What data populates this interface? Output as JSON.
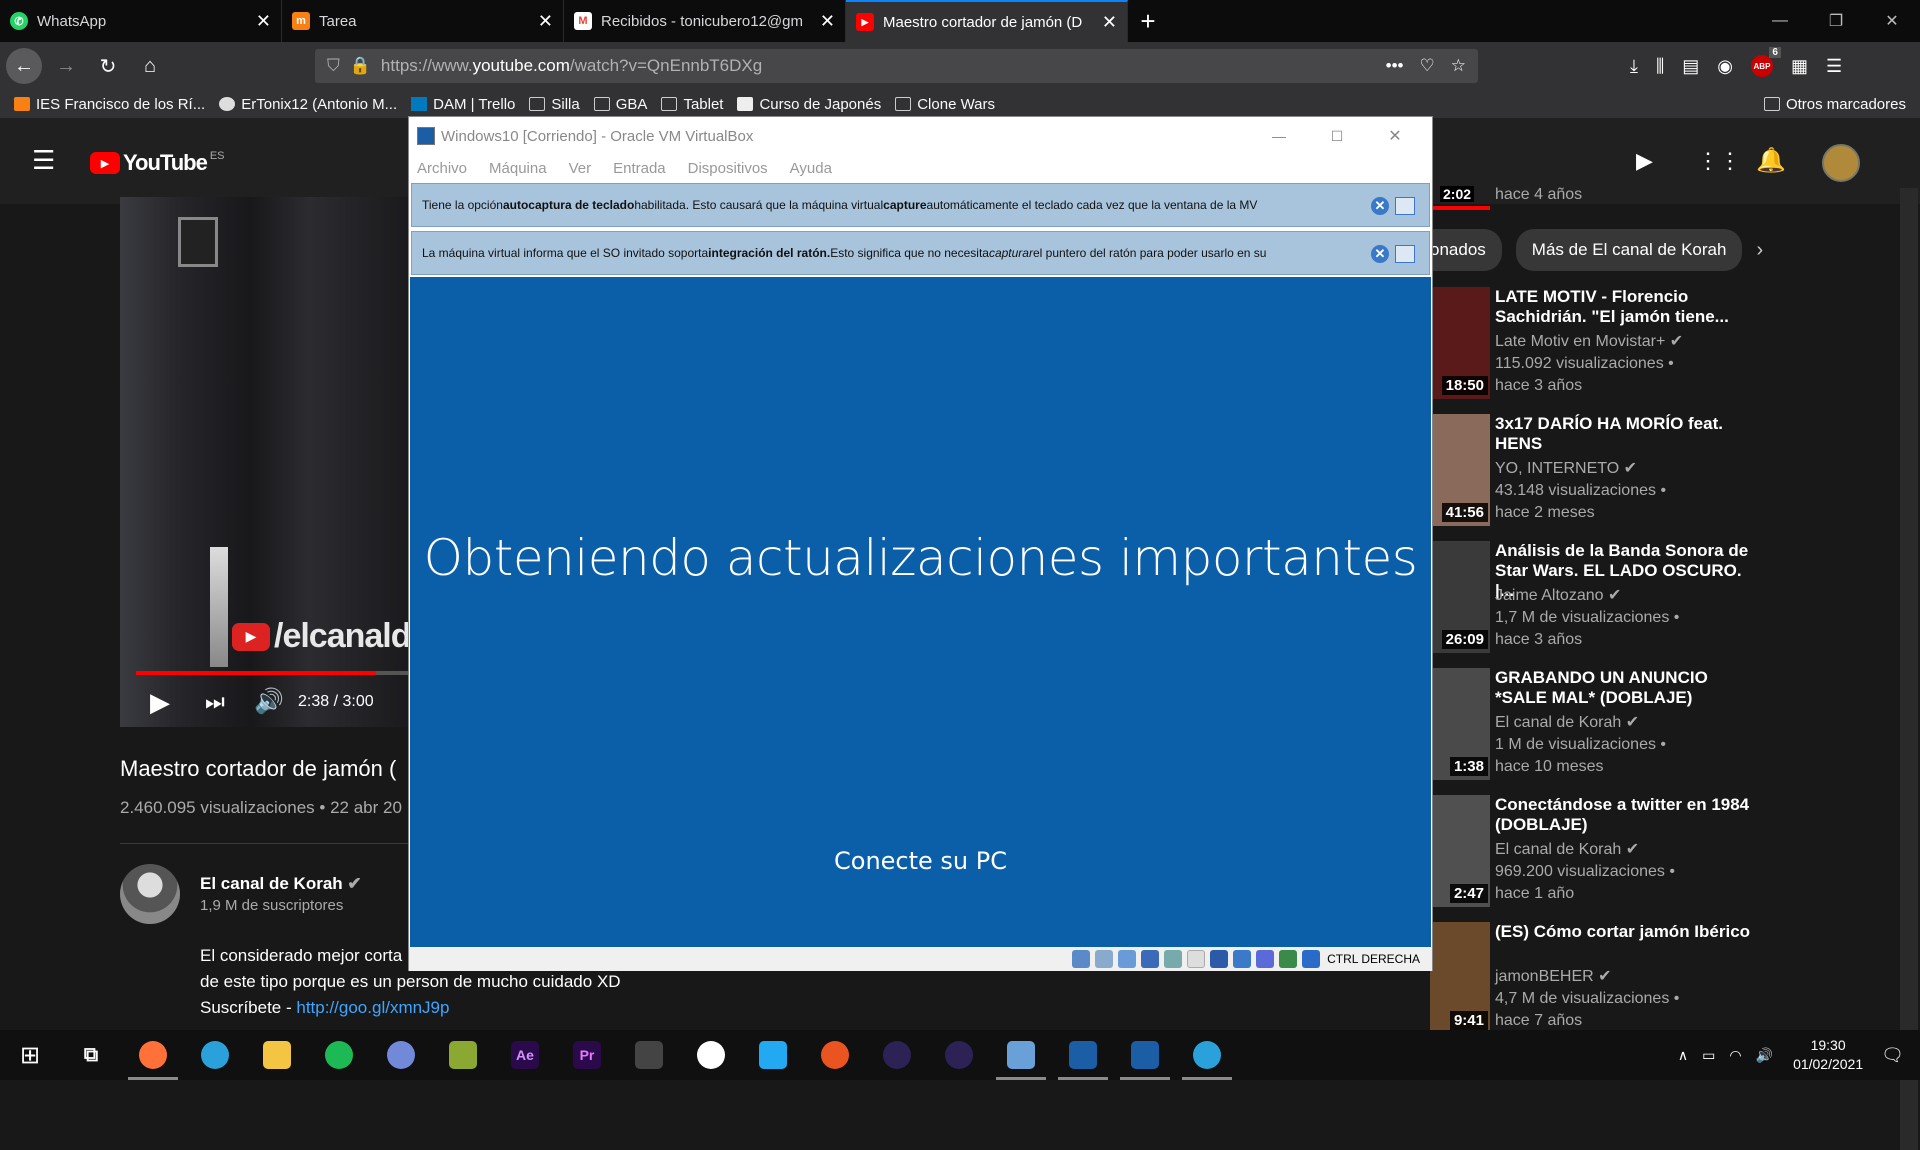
{
  "browser": {
    "tabs": [
      {
        "title": "WhatsApp",
        "icon": "whatsapp-icon",
        "color": "#25d366"
      },
      {
        "title": "Tarea",
        "icon": "moodle-icon",
        "color": "#f98012"
      },
      {
        "title": "Recibidos - tonicubero12@gm",
        "icon": "gmail-icon",
        "color": "#ea4335"
      },
      {
        "title": "Maestro cortador de jamón (D",
        "icon": "youtube-icon",
        "color": "#ff0000"
      }
    ],
    "url": {
      "prefix": "https://www.",
      "host": "youtube.com",
      "path": "/watch?v=QnEnnbT6DXg"
    },
    "addon_badge": "6",
    "bookmarks": [
      "IES Francisco de los Rí...",
      "ErTonix12 (Antonio M...",
      "DAM | Trello",
      "Silla",
      "GBA",
      "Tablet",
      "Curso de Japonés",
      "Clone Wars"
    ],
    "other_bookmarks": "Otros marcadores"
  },
  "youtube": {
    "logo_text": "YouTube",
    "region": "ES",
    "video": {
      "watermark": "/elcanaldek",
      "time": "2:38 / 3:00",
      "progress": 0.877,
      "title": "Maestro cortador de jamón (",
      "stats": "2.460.095 visualizaciones • 22 abr 20"
    },
    "channel": {
      "name": "El canal de Korah",
      "subs": "1,9 M de suscriptores"
    },
    "description": {
      "line1": "El considerado mejor corta",
      "line2": "de este tipo porque es un person de mucho cuidado XD",
      "line3_prefix": "Suscríbete - ",
      "link": "http://goo.gl/xmnJ9p"
    },
    "chips": [
      "onados",
      "Más de El canal de Korah"
    ],
    "top_partial": {
      "duration": "2:02",
      "age": "hace 4 años"
    },
    "recommendations": [
      {
        "title": "LATE MOTIV - Florencio Sachidrián. \"El jamón tiene...",
        "channel": "Late Motiv en Movistar+",
        "views": "115.092 visualizaciones •",
        "age": "hace 3 años",
        "duration": "18:50",
        "thumb": "#5a1a1a"
      },
      {
        "title": "3x17 DARÍO HA MORÍO feat. HENS",
        "channel": "YO, INTERNETO",
        "views": "43.148 visualizaciones •",
        "age": "hace 2 meses",
        "duration": "41:56",
        "thumb": "#8a6a5a"
      },
      {
        "title": "Análisis de la Banda Sonora de Star Wars. EL LADO OSCURO. |...",
        "channel": "Jaime Altozano",
        "views": "1,7 M de visualizaciones •",
        "age": "hace 3 años",
        "duration": "26:09",
        "thumb": "#3a3a3a"
      },
      {
        "title": "GRABANDO UN ANUNCIO *SALE MAL* (DOBLAJE)",
        "channel": "El canal de Korah",
        "views": "1 M de visualizaciones •",
        "age": "hace 10 meses",
        "duration": "1:38",
        "thumb": "#4a4a4a"
      },
      {
        "title": "Conectándose a twitter en 1984 (DOBLAJE)",
        "channel": "El canal de Korah",
        "views": "969.200 visualizaciones •",
        "age": "hace 1 año",
        "duration": "2:47",
        "thumb": "#505050"
      },
      {
        "title": "(ES) Cómo cortar jamón Ibérico",
        "channel": "jamonBEHER",
        "views": "4,7 M de visualizaciones •",
        "age": "hace 7 años",
        "duration": "9:41",
        "thumb": "#6a4a2a"
      }
    ]
  },
  "virtualbox": {
    "title": "Windows10 [Corriendo] - Oracle VM VirtualBox",
    "menu": [
      "Archivo",
      "Máquina",
      "Ver",
      "Entrada",
      "Dispositivos",
      "Ayuda"
    ],
    "banner1": {
      "a": "Tiene la opción ",
      "b": "autocaptura de teclado",
      "c": " habilitada. Esto causará que la máquina virtual ",
      "d": "capture",
      "e": " automáticamente el teclado cada vez que la ventana de la MV"
    },
    "banner2": {
      "a": "La máquina virtual informa que el SO invitado soporta ",
      "b": "integración del ratón.",
      "c": " Esto significa que no necesita ",
      "d": "capturar",
      "e": " el puntero del ratón para poder usarlo en su"
    },
    "screen_title": "Obteniendo actualizaciones importantes",
    "screen_sub": "Conecte su PC",
    "host_key": "CTRL DERECHA"
  },
  "taskbar": {
    "apps": [
      {
        "name": "task-view-icon",
        "label": "",
        "color": "transparent",
        "run": false
      },
      {
        "name": "firefox-icon",
        "label": "",
        "color": "#ff7139",
        "run": true
      },
      {
        "name": "telegram-icon",
        "label": "",
        "color": "#2aa1da",
        "run": false
      },
      {
        "name": "file-explorer-icon",
        "label": "",
        "color": "#f4c542",
        "run": false
      },
      {
        "name": "spotify-icon",
        "label": "",
        "color": "#1db954",
        "run": false
      },
      {
        "name": "discord-icon",
        "label": "",
        "color": "#7289da",
        "run": false
      },
      {
        "name": "gimp-icon",
        "label": "",
        "color": "#8aa832",
        "run": false
      },
      {
        "name": "after-effects-icon",
        "label": "Ae",
        "color": "#2a0a4a",
        "run": false
      },
      {
        "name": "premiere-icon",
        "label": "Pr",
        "color": "#2a0a4a",
        "run": false
      },
      {
        "name": "video-editor-icon",
        "label": "",
        "color": "#444",
        "run": false
      },
      {
        "name": "github-icon",
        "label": "",
        "color": "#fff",
        "run": false
      },
      {
        "name": "vscode-icon",
        "label": "",
        "color": "#23a9f2",
        "run": false
      },
      {
        "name": "ubuntu-icon",
        "label": "",
        "color": "#e95420",
        "run": false
      },
      {
        "name": "eclipse-icon",
        "label": "",
        "color": "#2c2255",
        "run": false
      },
      {
        "name": "eclipse2-icon",
        "label": "",
        "color": "#2c2255",
        "run": false
      },
      {
        "name": "krita-icon",
        "label": "",
        "color": "#6aa0d8",
        "run": true
      },
      {
        "name": "virtualbox-icon",
        "label": "",
        "color": "#1b5ea6",
        "run": true
      },
      {
        "name": "virtualbox-vm-icon",
        "label": "",
        "color": "#1b5ea6",
        "run": true
      },
      {
        "name": "telegram2-icon",
        "label": "",
        "color": "#2aa1da",
        "run": true
      }
    ],
    "time": "19:30",
    "date": "01/02/2021"
  }
}
